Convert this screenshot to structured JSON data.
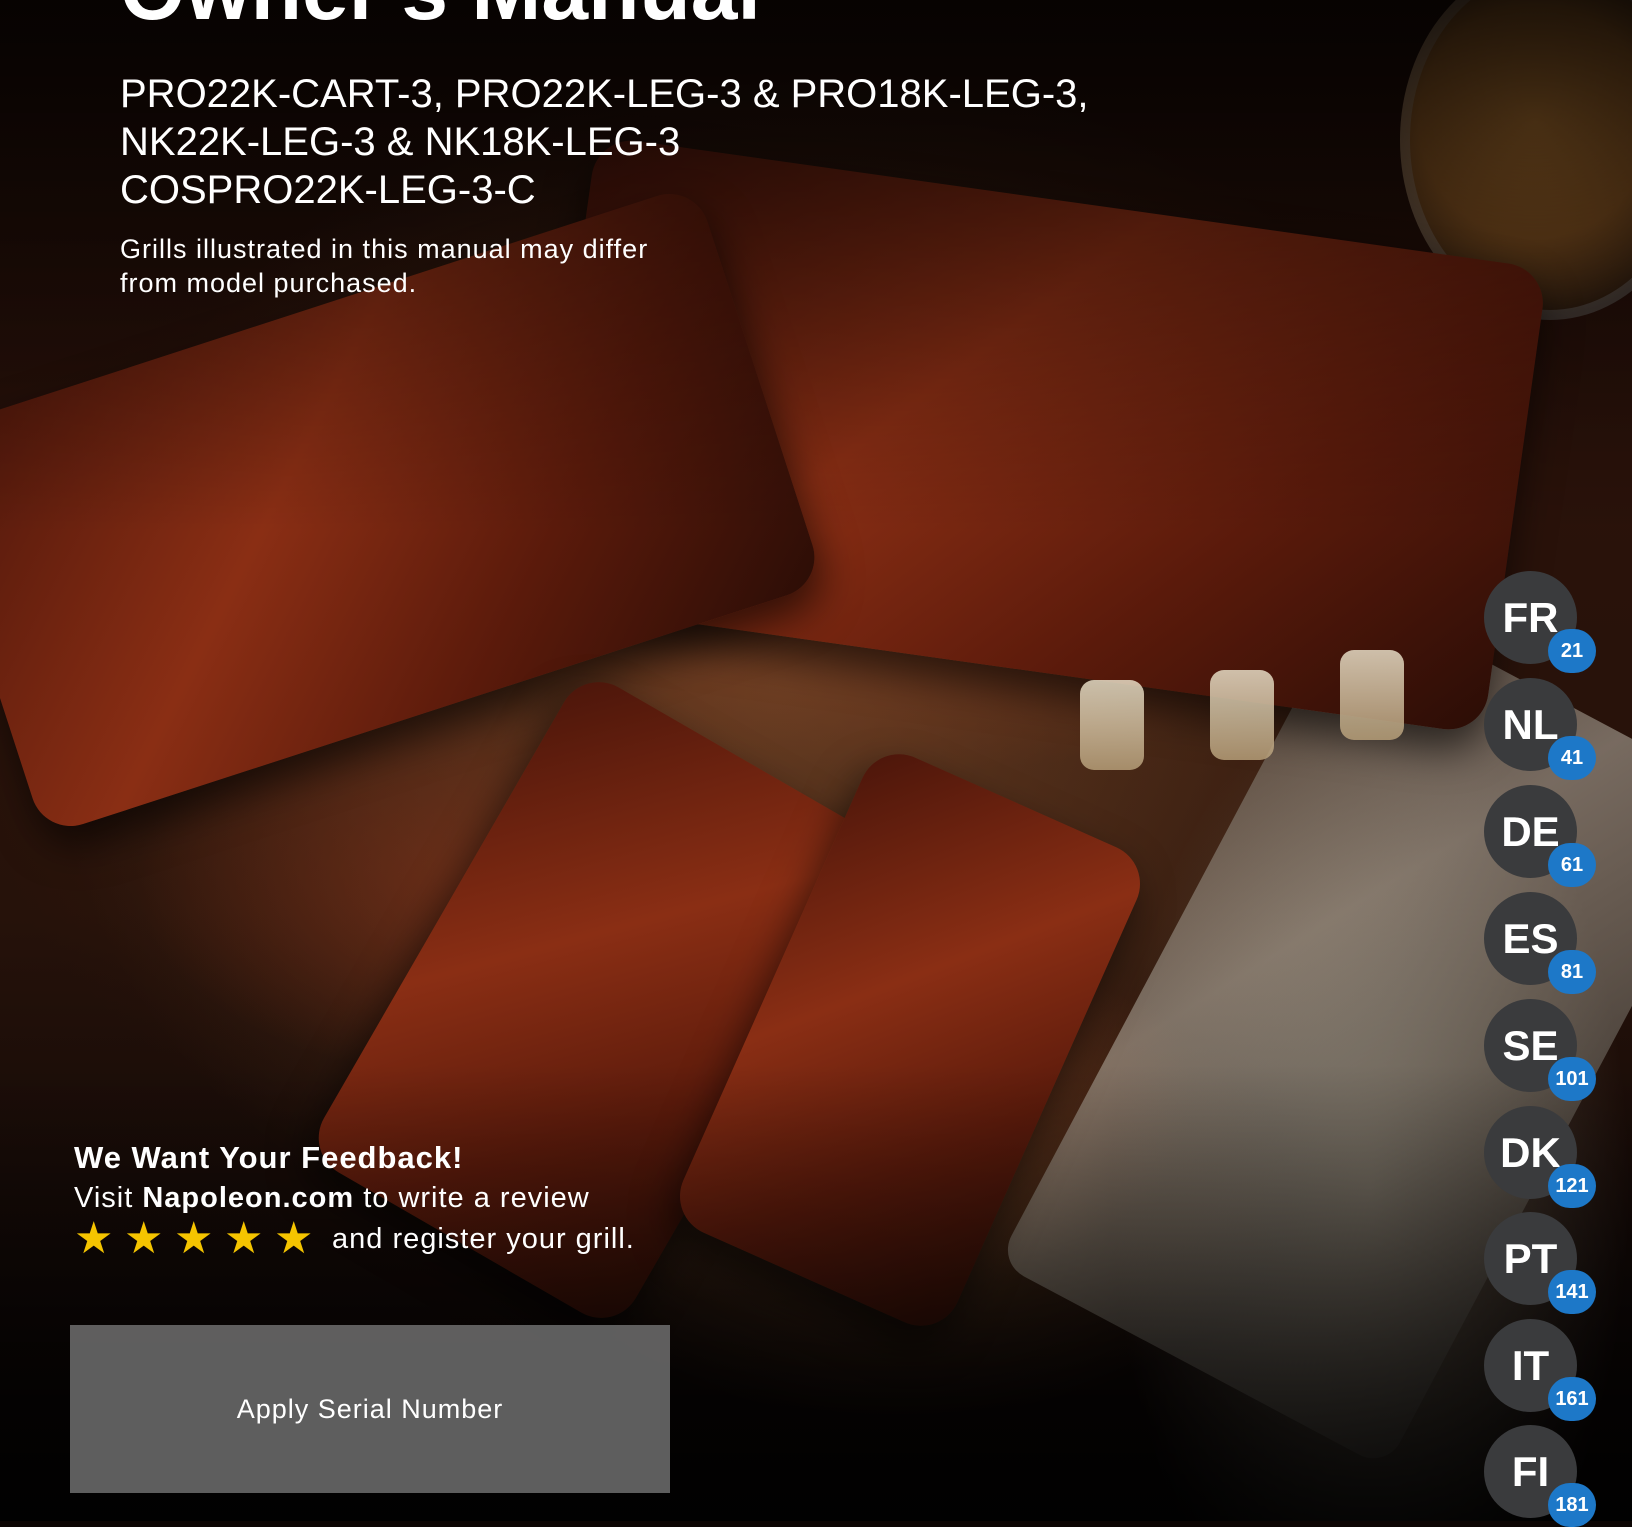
{
  "cover": {
    "title": "Owner's Manual",
    "models": [
      "PRO22K-CART-3, PRO22K-LEG-3 & PRO18K-LEG-3,",
      "NK22K-LEG-3 & NK18K-LEG-3",
      "COSPRO22K-LEG-3-C"
    ],
    "disclaimer": [
      "Grills illustrated in this manual may differ",
      "from model purchased."
    ]
  },
  "feedback": {
    "title": "We Want Your Feedback!",
    "visit_prefix": "Visit ",
    "site": "Napoleon.com",
    "visit_suffix": " to write a review",
    "stars": 5,
    "register_text": "and register your grill."
  },
  "serial": {
    "label": "Apply Serial Number"
  },
  "languages": [
    {
      "code": "FR",
      "page": "21"
    },
    {
      "code": "NL",
      "page": "41"
    },
    {
      "code": "DE",
      "page": "61"
    },
    {
      "code": "ES",
      "page": "81"
    },
    {
      "code": "SE",
      "page": "101"
    },
    {
      "code": "DK",
      "page": "121"
    },
    {
      "code": "PT",
      "page": "141"
    },
    {
      "code": "IT",
      "page": "161"
    },
    {
      "code": "FI",
      "page": "181"
    }
  ],
  "colors": {
    "star": "#f5c400",
    "badge_circle": "#3a3b3d",
    "page_badge": "#1d78c8",
    "serial_box": "#6e6e6e"
  }
}
